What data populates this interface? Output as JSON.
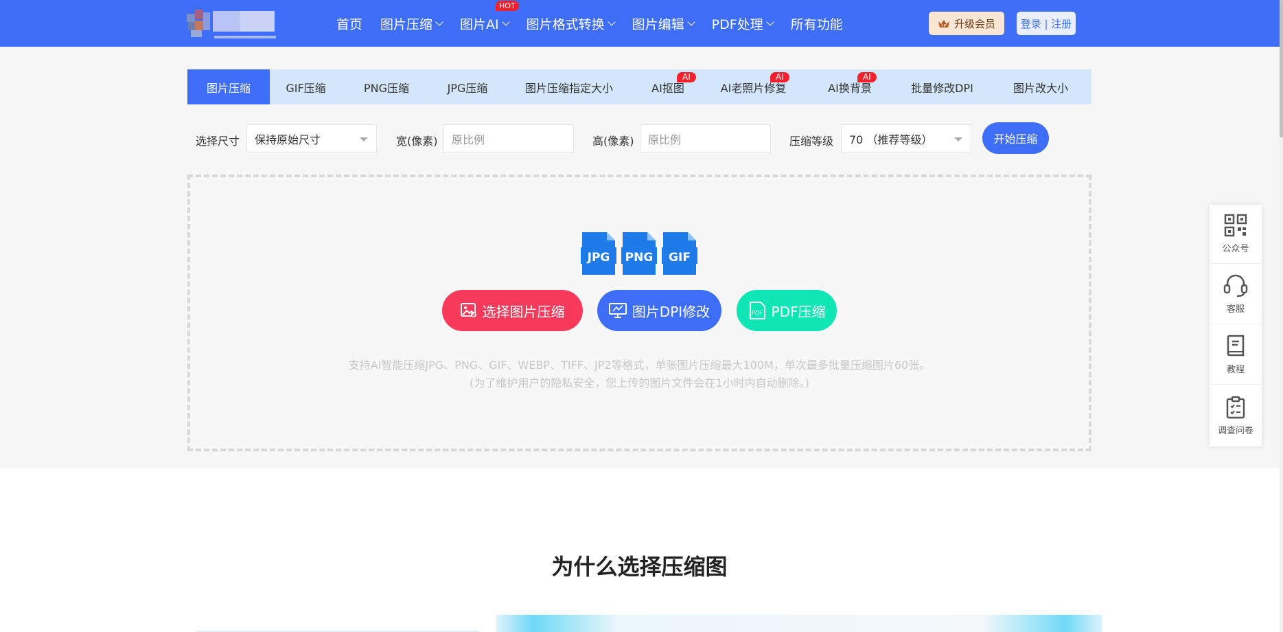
{
  "header": {
    "nav": [
      {
        "label": "首页",
        "dropdown": false
      },
      {
        "label": "图片压缩",
        "dropdown": true
      },
      {
        "label": "图片AI",
        "dropdown": true,
        "badge": "HOT"
      },
      {
        "label": "图片格式转换",
        "dropdown": true
      },
      {
        "label": "图片编辑",
        "dropdown": true
      },
      {
        "label": "PDF处理",
        "dropdown": true
      },
      {
        "label": "所有功能",
        "dropdown": false
      }
    ],
    "vip_label": "升级会员",
    "login_label": "登录 | 注册"
  },
  "tabs": [
    {
      "label": "图片压缩",
      "active": true
    },
    {
      "label": "GIF压缩"
    },
    {
      "label": "PNG压缩"
    },
    {
      "label": "JPG压缩"
    },
    {
      "label": "图片压缩指定大小"
    },
    {
      "label": "AI抠图",
      "badge": "AI"
    },
    {
      "label": "AI老照片修复",
      "badge": "AI"
    },
    {
      "label": "AI换背景",
      "badge": "AI"
    },
    {
      "label": "批量修改DPI"
    },
    {
      "label": "图片改大小"
    }
  ],
  "options": {
    "size_label": "选择尺寸",
    "size_value": "保持原始尺寸",
    "width_label": "宽(像素)",
    "width_placeholder": "原比例",
    "height_label": "高(像素)",
    "height_placeholder": "原比例",
    "level_label": "压缩等级",
    "level_value": "70 （推荐等级）",
    "start_label": "开始压缩"
  },
  "upload": {
    "file_types": [
      "JPG",
      "PNG",
      "GIF"
    ],
    "select_label": "选择图片压缩",
    "dpi_label": "图片DPI修改",
    "pdf_label": "PDF压缩",
    "pdf_icon_text": "PDF",
    "info_line1": "支持AI智能压缩JPG、PNG、GIF、WEBP、TIFF、JP2等格式，单张图片压缩最大100M，单次最多批量压缩图片60张。",
    "info_line2": "(为了维护用户的隐私安全，您上传的图片文件会在1小时内自动删除。)"
  },
  "side": [
    {
      "label": "公众号",
      "icon": "qrcode-icon"
    },
    {
      "label": "客服",
      "icon": "headset-icon"
    },
    {
      "label": "教程",
      "icon": "book-icon"
    },
    {
      "label": "调查问卷",
      "icon": "clipboard-icon"
    }
  ],
  "why_title": "为什么选择压缩图",
  "colors": {
    "primary": "#3d6ef5",
    "select_btn": "#f73a5b",
    "dpi_btn": "#3d6ef5",
    "pdf_btn": "#0ee6b5",
    "badge": "#f5222d"
  }
}
